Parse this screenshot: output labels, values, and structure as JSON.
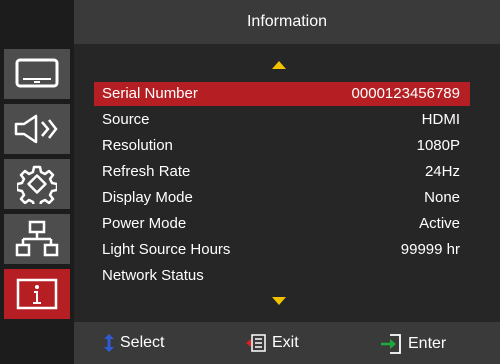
{
  "header": {
    "title": "Information"
  },
  "sidebar": {
    "items": [
      {
        "icon": "display-icon",
        "active": false
      },
      {
        "icon": "audio-icon",
        "active": false
      },
      {
        "icon": "settings-icon",
        "active": false
      },
      {
        "icon": "network-icon",
        "active": false
      },
      {
        "icon": "info-icon",
        "active": true
      }
    ]
  },
  "info": {
    "rows": [
      {
        "label": "Serial Number",
        "value": "0000123456789",
        "selected": true
      },
      {
        "label": "Source",
        "value": "HDMI"
      },
      {
        "label": "Resolution",
        "value": "1080P"
      },
      {
        "label": "Refresh Rate",
        "value": "24Hz"
      },
      {
        "label": "Display Mode",
        "value": "None"
      },
      {
        "label": "Power Mode",
        "value": "Active"
      },
      {
        "label": "Light Source Hours",
        "value": "99999 hr"
      },
      {
        "label": "Network Status",
        "value": ""
      }
    ]
  },
  "footer": {
    "select_label": "Select",
    "exit_label": "Exit",
    "enter_label": "Enter"
  },
  "colors": {
    "accent": "#b51f23",
    "arrow": "#f2c200",
    "select_icon": "#2f5bd6",
    "exit_icon": "#d92020",
    "enter_icon": "#1fa83a"
  }
}
